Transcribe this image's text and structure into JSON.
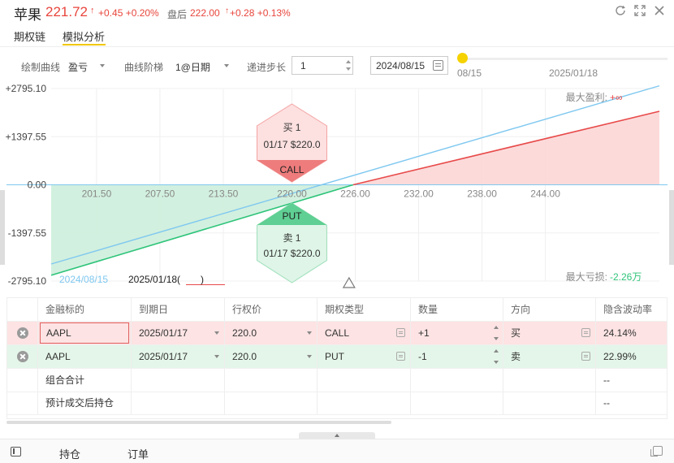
{
  "header": {
    "name": "苹果",
    "price": "221.72",
    "arrow": "↑",
    "change": "+0.45 +0.20%",
    "after_hours_label": "盘后",
    "after_hours_price": "222.00",
    "after_hours_arrow": "↑",
    "after_hours_change": "+0.28 +0.13%",
    "icons": [
      "refresh-icon",
      "expand-icon",
      "close-icon"
    ]
  },
  "tabs": [
    {
      "label": "期权链",
      "active": false
    },
    {
      "label": "模拟分析",
      "active": true
    }
  ],
  "controls": {
    "curve_label": "绘制曲线",
    "curve_value": "盈亏",
    "ladder_label": "曲线阶梯",
    "ladder_value": "1@日期",
    "step_label": "递进步长",
    "step_value": "1",
    "date_value": "2024/08/15",
    "slider_start": "08/15",
    "slider_end": "2025/01/18",
    "slider_position": 0.0
  },
  "chart_data": {
    "type": "line",
    "y_ticks": [
      "+2795.10",
      "+1397.55",
      "0.00",
      "-1397.55",
      "-2795.10"
    ],
    "x_ticks": [
      "201.50",
      "207.50",
      "213.50",
      "220.00",
      "226.00",
      "232.00",
      "238.00",
      "244.00"
    ],
    "x_range": [
      197.2,
      254.8
    ],
    "y_range": [
      -2795.1,
      2795.1
    ],
    "max_profit_label": "最大盈利:",
    "max_profit_value": "+∞",
    "max_loss_label": "最大亏损:",
    "max_loss_value": "-2.26万",
    "legend_blue": "2024/08/15",
    "legend_black": "2025/01/18(",
    "legend_red_mark": "⎽⎽⎽⎽",
    "legend_close": ")",
    "series": [
      {
        "name": "2024/08/15",
        "color": "#7fc8f0",
        "x": [
          197.2,
          254.8
        ],
        "y": [
          -2300,
          2875
        ]
      },
      {
        "name": "2025/01/18",
        "color": "#e84a4a",
        "x": [
          197.2,
          254.8
        ],
        "y": [
          -2626,
          2134
        ]
      }
    ],
    "breakeven": 225.8,
    "current_price": 221.72,
    "colors": {
      "profit_fill": "#fcd6d6",
      "loss_fill": "#cdeedc",
      "profit_line": "#e84a4a",
      "loss_line": "#2ec47a",
      "zero_line": "#7fc8f0"
    },
    "buy_badge": {
      "title": "买 1",
      "detail": "01/17 $220.0",
      "type": "CALL",
      "color": "#f5a3a3",
      "strip": "#ee7c7c"
    },
    "sell_badge": {
      "title": "卖 1",
      "detail": "01/17 $220.0",
      "type": "PUT",
      "color": "#9ee0bb",
      "strip": "#5fcf93"
    }
  },
  "table": {
    "headers": [
      "金融标的",
      "到期日",
      "行权价",
      "期权类型",
      "数量",
      "方向",
      "隐含波动率"
    ],
    "rows": [
      {
        "symbol": "AAPL",
        "expiry": "2025/01/17",
        "strike": "220.0",
        "type": "CALL",
        "qty": "+1",
        "side": "买",
        "iv": "24.14%"
      },
      {
        "symbol": "AAPL",
        "expiry": "2025/01/17",
        "strike": "220.0",
        "type": "PUT",
        "qty": "-1",
        "side": "卖",
        "iv": "22.99%"
      }
    ],
    "summary_total": "组合合计",
    "summary_total_iv": "--",
    "summary_after": "预计成交后持仓",
    "summary_after_iv": "--"
  },
  "bottom": {
    "tab_positions": "持仓",
    "tab_orders": "订单"
  }
}
